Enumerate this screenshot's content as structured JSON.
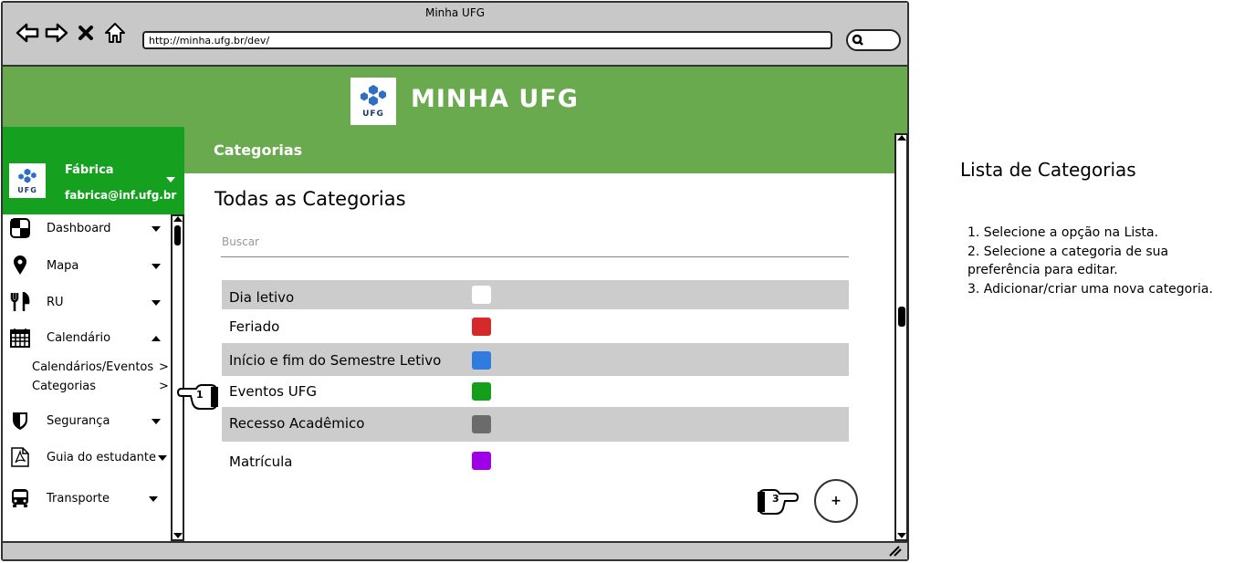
{
  "window": {
    "title": "Minha UFG",
    "url": "http://minha.ufg.br/dev/"
  },
  "header": {
    "logo_text": "UFG",
    "app_title": "MINHA UFG"
  },
  "profile": {
    "name": "Fábrica",
    "email": "fabrica@inf.ufg.br",
    "logo_text": "UFG"
  },
  "sidebar": {
    "items": [
      {
        "label": "Dashboard",
        "icon": "dashboard-icon",
        "expanded": false
      },
      {
        "label": "Mapa",
        "icon": "map-pin-icon",
        "expanded": false
      },
      {
        "label": "RU",
        "icon": "fork-knife-icon",
        "expanded": false
      },
      {
        "label": "Calendário",
        "icon": "calendar-icon",
        "expanded": true
      },
      {
        "label": "Segurança",
        "icon": "shield-icon",
        "expanded": false
      },
      {
        "label": "Guia do estudante",
        "icon": "pdf-icon",
        "expanded": false
      },
      {
        "label": "Transporte",
        "icon": "bus-icon",
        "expanded": false
      }
    ],
    "sub_items": [
      {
        "label": "Calendários/Eventos",
        "arrow": ">"
      },
      {
        "label": "Categorias",
        "arrow": ">"
      }
    ]
  },
  "page": {
    "section_title": "Categorias",
    "heading": "Todas as Categorias",
    "search_placeholder": "Buscar",
    "categories": [
      {
        "name": "Dia letivo",
        "color": "#ffffff"
      },
      {
        "name": "Feriado",
        "color": "#d42a2a"
      },
      {
        "name": "Início e fim do Semestre Letivo",
        "color": "#2f7be0"
      },
      {
        "name": "Eventos UFG",
        "color": "#12a01a"
      },
      {
        "name": "Recesso Acadêmico",
        "color": "#6b6b6b"
      },
      {
        "name": "Matrícula",
        "color": "#a000e8"
      }
    ],
    "add_button_label": "+"
  },
  "markers": {
    "step1": "1",
    "step3": "3"
  },
  "annotation": {
    "title": "Lista de Categorias",
    "steps": [
      "1. Selecione a opção na Lista.",
      "2. Selecione a categoria de sua preferência para editar.",
      "3. Adicionar/criar uma nova categoria."
    ]
  }
}
